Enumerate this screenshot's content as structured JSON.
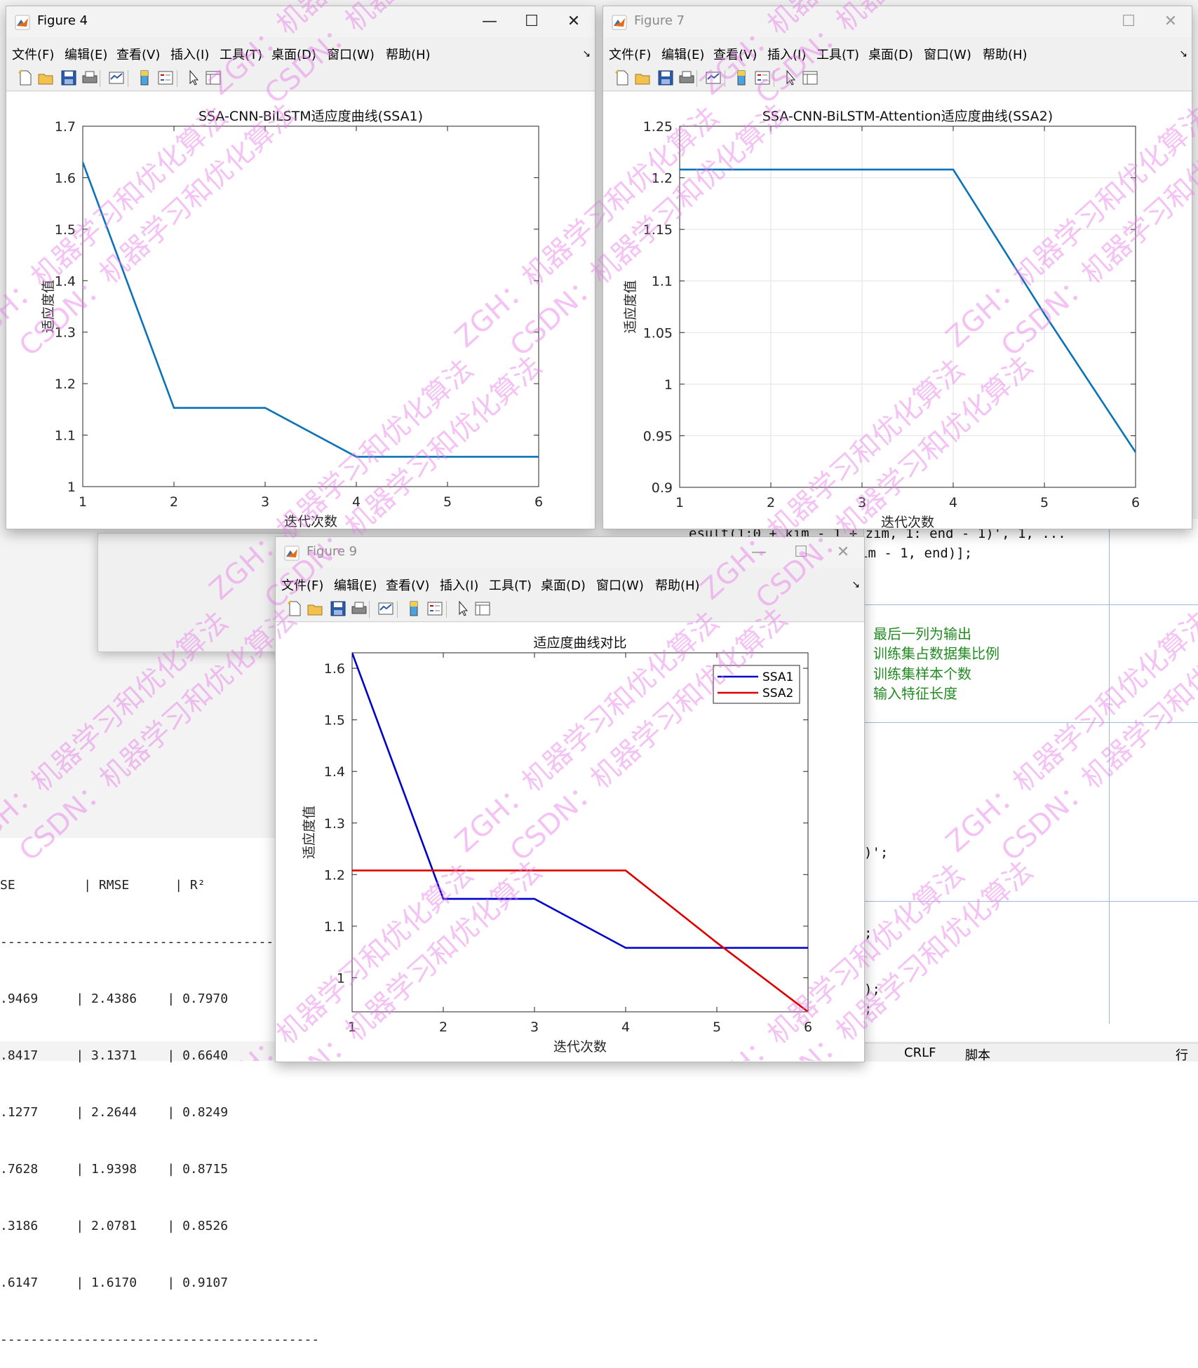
{
  "colors": {
    "series_blue_single": "#0a72b9",
    "ssa1": "#0000cc",
    "ssa2": "#dd0000",
    "comment_green": "#228b22",
    "grid": "#e2e2e2"
  },
  "menus": [
    "文件(F)",
    "编辑(E)",
    "查看(V)",
    "插入(I)",
    "工具(T)",
    "桌面(D)",
    "窗口(W)",
    "帮助(H)"
  ],
  "toolbar_icons": [
    "new-figure-icon",
    "open-file-icon",
    "save-icon",
    "print-icon",
    "link-plot-icon",
    "insert-colorbar-icon",
    "insert-legend-icon",
    "edit-plot-arrow-icon",
    "property-inspector-icon"
  ],
  "window_controls": {
    "minimize": "—",
    "maximize": "☐",
    "close": "✕"
  },
  "menu_overflow_arrow": "↘",
  "fig4": {
    "title": "Figure 4",
    "chart_data": {
      "type": "line",
      "title": "SSA-CNN-BiLSTM适应度曲线(SSA1)",
      "xlabel": "迭代次数",
      "ylabel": "适应度值",
      "x": [
        1,
        2,
        3,
        4,
        5,
        6
      ],
      "series": [
        {
          "values": [
            1.63,
            1.153,
            1.153,
            1.058,
            1.058,
            1.058
          ]
        }
      ],
      "xlim": [
        1,
        6
      ],
      "ylim": [
        1,
        1.7
      ],
      "xticks": [
        "1",
        "2",
        "3",
        "4",
        "5",
        "6"
      ],
      "yticks": [
        "1",
        "1.1",
        "1.2",
        "1.3",
        "1.4",
        "1.5",
        "1.6",
        "1.7"
      ],
      "grid": false
    }
  },
  "fig7": {
    "title": "Figure 7",
    "chart_data": {
      "type": "line",
      "title": "SSA-CNN-BiLSTM-Attention适应度曲线(SSA2)",
      "xlabel": "迭代次数",
      "ylabel": "适应度值",
      "x": [
        1,
        2,
        3,
        4,
        5,
        6
      ],
      "series": [
        {
          "values": [
            1.208,
            1.208,
            1.208,
            1.208,
            1.068,
            0.934
          ]
        }
      ],
      "xlim": [
        1,
        6
      ],
      "ylim": [
        0.9,
        1.25
      ],
      "xticks": [
        "1",
        "2",
        "3",
        "4",
        "5",
        "6"
      ],
      "yticks": [
        "0.9",
        "0.95",
        "1",
        "1.05",
        "1.1",
        "1.15",
        "1.2",
        "1.25"
      ],
      "grid": true
    }
  },
  "fig9": {
    "title": "Figure 9",
    "chart_data": {
      "type": "line",
      "title": "适应度曲线对比",
      "xlabel": "迭代次数",
      "ylabel": "适应度值",
      "x": [
        1,
        2,
        3,
        4,
        5,
        6
      ],
      "series": [
        {
          "name": "SSA1",
          "values": [
            1.63,
            1.153,
            1.153,
            1.058,
            1.058,
            1.058
          ]
        },
        {
          "name": "SSA2",
          "values": [
            1.208,
            1.208,
            1.208,
            1.208,
            1.068,
            0.934
          ]
        }
      ],
      "xlim": [
        1,
        6
      ],
      "ylim": [
        0.934,
        1.63
      ],
      "xticks": [
        "1",
        "2",
        "3",
        "4",
        "5",
        "6"
      ],
      "yticks": [
        "1",
        "1.1",
        "1.2",
        "1.3",
        "1.4",
        "1.5",
        "1.6"
      ],
      "legend_position": "top-right",
      "grid": false
    }
  },
  "console": {
    "header": "SE         | RMSE      | R²",
    "divider": "------------------------------------------",
    "rows": [
      ".9469     | 2.4386    | 0.7970",
      ".8417     | 3.1371    | 0.6640",
      ".1277     | 2.2644    | 0.8249",
      ".7628     | 1.9398    | 0.8715",
      ".3186     | 2.0781    | 0.8526",
      ".6147     | 1.6170    | 0.9107"
    ]
  },
  "editor": {
    "line1": "esult(1:0 + kim - 1 + zim, 1: end - 1)', 1, ...",
    "line2": "im - 1, end)];",
    "comments": [
      "最后一列为输出",
      "训练集占数据集比例",
      "训练集样本个数",
      "输入特征长度"
    ],
    "frag1": ")';",
    "frag2": ";",
    "frag3": ");",
    "frag4": ";"
  },
  "statusbar": {
    "eol": "CRLF",
    "type": "脚本",
    "line": "行"
  },
  "watermark": {
    "line1": "ZGH：机器学习和优化算法",
    "line2": "CSDN：机器学习和优化算法"
  }
}
